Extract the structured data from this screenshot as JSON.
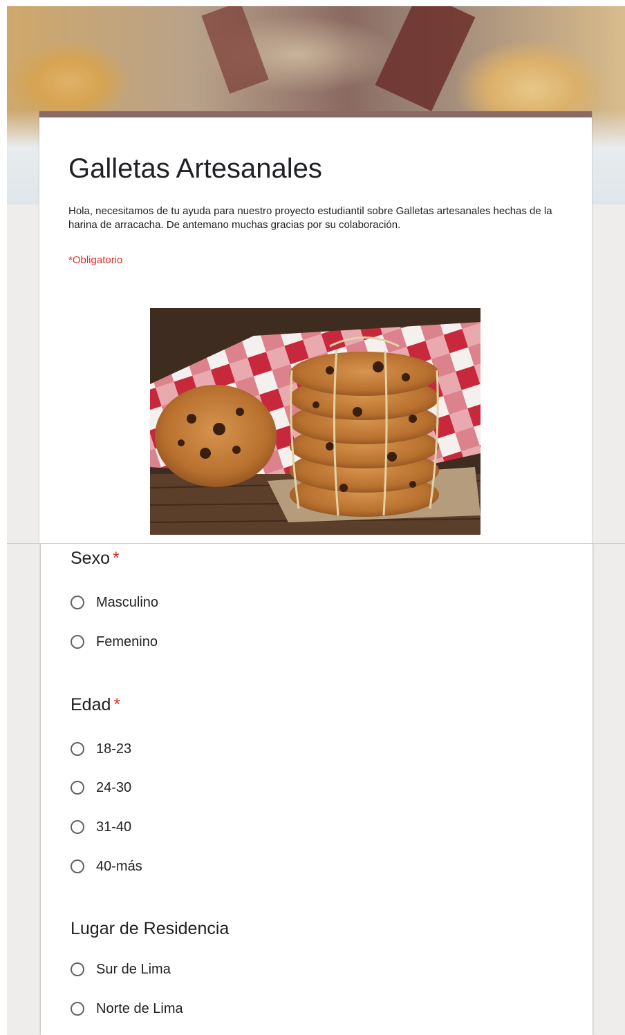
{
  "form": {
    "title": "Galletas Artesanales",
    "description": "Hola, necesitamos de tu ayuda para nuestro proyecto estudiantil sobre Galletas artesanales hechas de la harina de arracacha. De antemano muchas gracias por su colaboración.",
    "required_note": "*Obligatorio",
    "theme_color": "#8a6a66",
    "background_color": "#efedeb"
  },
  "questions": [
    {
      "title": "Sexo",
      "required_mark": "*",
      "options": [
        "Masculino",
        "Femenino"
      ]
    },
    {
      "title": "Edad",
      "required_mark": "*",
      "options": [
        "18-23",
        "24-30",
        "31-40",
        "40-más"
      ]
    },
    {
      "title": "Lugar de Residencia",
      "required_mark": "",
      "options": [
        "Sur de Lima",
        "Norte de Lima"
      ]
    }
  ]
}
